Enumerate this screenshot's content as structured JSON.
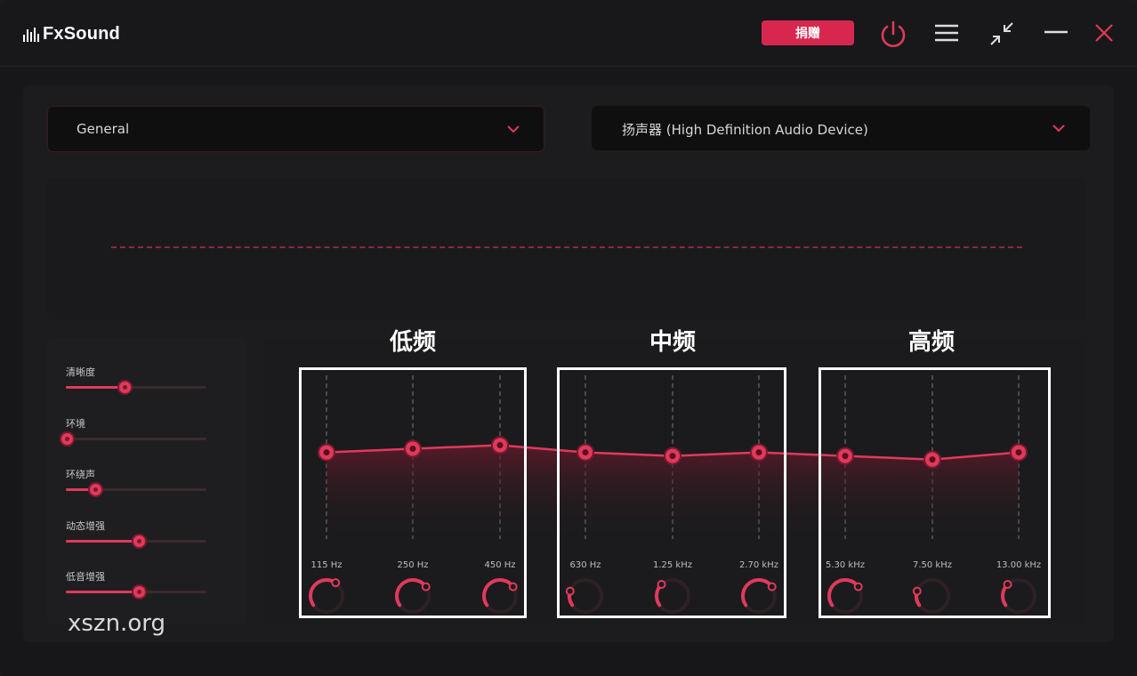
{
  "app": {
    "name": "FxSound",
    "donate_label": "捐赠"
  },
  "colors": {
    "accent": "#e0395c",
    "background": "#171719",
    "panel": "#1c1c1e"
  },
  "titlebar": {
    "icons": [
      "power-icon",
      "menu-icon",
      "collapse-icon",
      "minimize-icon",
      "close-icon"
    ]
  },
  "preset": {
    "value": "General"
  },
  "output_device": {
    "value": "扬声器 (High Definition Audio Device)"
  },
  "effects": [
    {
      "label": "清晰度",
      "value": 0.41
    },
    {
      "label": "环境",
      "value": 0.0
    },
    {
      "label": "环绕声",
      "value": 0.2
    },
    {
      "label": "动态增强",
      "value": 0.51
    },
    {
      "label": "低音增强",
      "value": 0.51
    }
  ],
  "eq": {
    "groups": [
      "低频",
      "中频",
      "高频"
    ],
    "bands": [
      {
        "freq": "115 Hz",
        "level": 0.48,
        "knob": 0.55
      },
      {
        "freq": "250 Hz",
        "level": 0.44,
        "knob": 0.62
      },
      {
        "freq": "450 Hz",
        "level": 0.4,
        "knob": 0.62
      },
      {
        "freq": "630 Hz",
        "level": 0.48,
        "knob": 0.18
      },
      {
        "freq": "1.25 kHz",
        "level": 0.52,
        "knob": 0.28
      },
      {
        "freq": "2.70 kHz",
        "level": 0.48,
        "knob": 0.62
      },
      {
        "freq": "5.30 kHz",
        "level": 0.52,
        "knob": 0.62
      },
      {
        "freq": "7.50 kHz",
        "level": 0.56,
        "knob": 0.18
      },
      {
        "freq": "13.00 kHz",
        "level": 0.48,
        "knob": 0.28
      }
    ]
  },
  "watermark": "xszn.org"
}
